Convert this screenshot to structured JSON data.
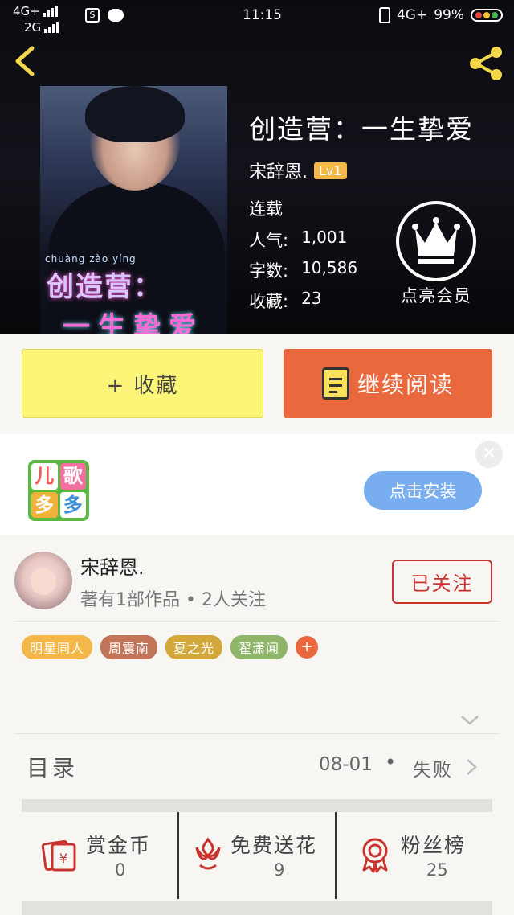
{
  "statusbar": {
    "network_top": "4G+",
    "network_bottom": "2G",
    "sim_icon_text": "S",
    "time": "11:15",
    "network_right": "4G+",
    "battery": "99%"
  },
  "book": {
    "title": "创造营：一生挚爱",
    "author": "宋辞恩.",
    "level": "Lv1",
    "status": "连载",
    "popularity_label": "人气:",
    "popularity_value": "1,001",
    "words_label": "字数:",
    "words_value": "10,586",
    "favorites_label": "收藏:",
    "favorites_value": "23",
    "cover_pinyin": "chuàng zào yíng",
    "cover_title_line1": "创造营：",
    "cover_title_line2": "一生挚爱"
  },
  "vip": {
    "label": "点亮会员"
  },
  "actions": {
    "collect_label": "+ 收藏",
    "read_label": "继续阅读"
  },
  "ad": {
    "logo_chars": [
      "儿",
      "歌",
      "多",
      "多"
    ],
    "install_label": "点击安装",
    "close_symbol": "✕"
  },
  "author_section": {
    "name": "宋辞恩.",
    "meta": "著有1部作品 • 2人关注",
    "follow_label": "已关注"
  },
  "tags": [
    {
      "label": "明星同人",
      "color": "#f4b84a"
    },
    {
      "label": "周震南",
      "color": "#c27458"
    },
    {
      "label": "夏之光",
      "color": "#d2a83c"
    },
    {
      "label": "翟潇闻",
      "color": "#8fb56a"
    }
  ],
  "tag_add_symbol": "+",
  "toc": {
    "label": "目录",
    "date": "08-01",
    "separator": "•",
    "status": "失败"
  },
  "bottom_bar": [
    {
      "label": "赏金币",
      "value": "0",
      "icon": "reward-coin-icon"
    },
    {
      "label": "免费送花",
      "value": "9",
      "icon": "flower-icon"
    },
    {
      "label": "粉丝榜",
      "value": "25",
      "icon": "medal-icon"
    }
  ],
  "colors": {
    "accent_orange": "#e9683d",
    "collect_yellow": "#fcf577",
    "follow_red": "#c9332e",
    "install_blue": "#78aef0"
  }
}
